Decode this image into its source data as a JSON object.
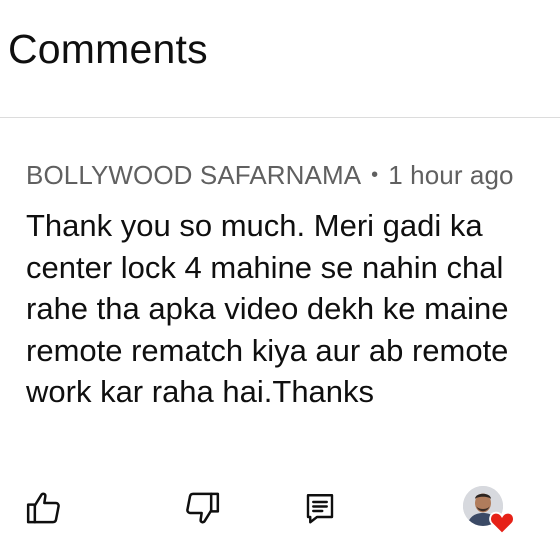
{
  "header": {
    "title": "Comments"
  },
  "comment": {
    "author": "BOLLYWOOD SAFARNAMA",
    "separator": "•",
    "time": "1 hour ago",
    "text_lines": [
      "Thank you so much. Meri gadi ka",
      "center lock 4 mahine se nahin chal",
      "rahe tha apka video dekh ke maine",
      "remote rematch kiya aur ab remote",
      "work kar raha hai.Thanks"
    ]
  },
  "actions": {
    "icons": [
      "thumbs-up-icon",
      "thumbs-down-icon",
      "reply-icon",
      "creator-heart-icon"
    ]
  },
  "colors": {
    "primary_text": "#0f0f0f",
    "secondary_text": "#606060",
    "divider": "#dcdcdc",
    "heart": "#e62117"
  }
}
